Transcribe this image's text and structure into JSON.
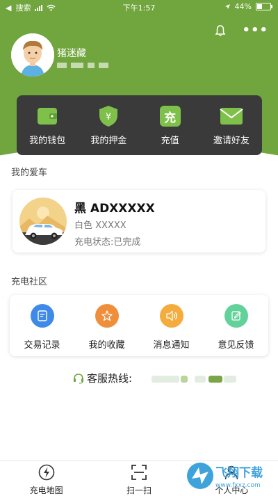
{
  "status_bar": {
    "carrier": "搜索",
    "time": "下午1:57",
    "battery": "44%",
    "battery_level": 0.44
  },
  "user": {
    "name": "猪迷藏"
  },
  "menu": [
    {
      "label": "我的钱包",
      "icon": "wallet-icon"
    },
    {
      "label": "我的押金",
      "icon": "shield-yen-icon"
    },
    {
      "label": "充值",
      "icon": "recharge-icon",
      "glyph": "充"
    },
    {
      "label": "邀请好友",
      "icon": "envelope-icon"
    }
  ],
  "my_car": {
    "section_title": "我的爱车",
    "plate": "黑 ADXXXXX",
    "color": "白色 XXXXX",
    "status": "充电状态:已完成"
  },
  "community": {
    "section_title": "充电社区",
    "items": [
      {
        "label": "交易记录",
        "icon": "receipt-icon",
        "color": "#3f8ae8"
      },
      {
        "label": "我的收藏",
        "icon": "star-icon",
        "color": "#ef8e3b"
      },
      {
        "label": "消息通知",
        "icon": "speaker-icon",
        "color": "#f5ac3e"
      },
      {
        "label": "意见反馈",
        "icon": "feedback-icon",
        "color": "#63d19a"
      }
    ]
  },
  "hotline": {
    "label": "客服热线:"
  },
  "tabbar": [
    {
      "label": "充电地图",
      "icon": "lightning-icon"
    },
    {
      "label": "扫一扫",
      "icon": "scan-icon"
    },
    {
      "label": "个人中心",
      "icon": "person-icon"
    }
  ],
  "watermark": {
    "text": "飞翔下载",
    "url": "www.fxxz.com"
  },
  "colors": {
    "brand_green": "#71a53d",
    "menu_card": "#3a3a3a"
  }
}
